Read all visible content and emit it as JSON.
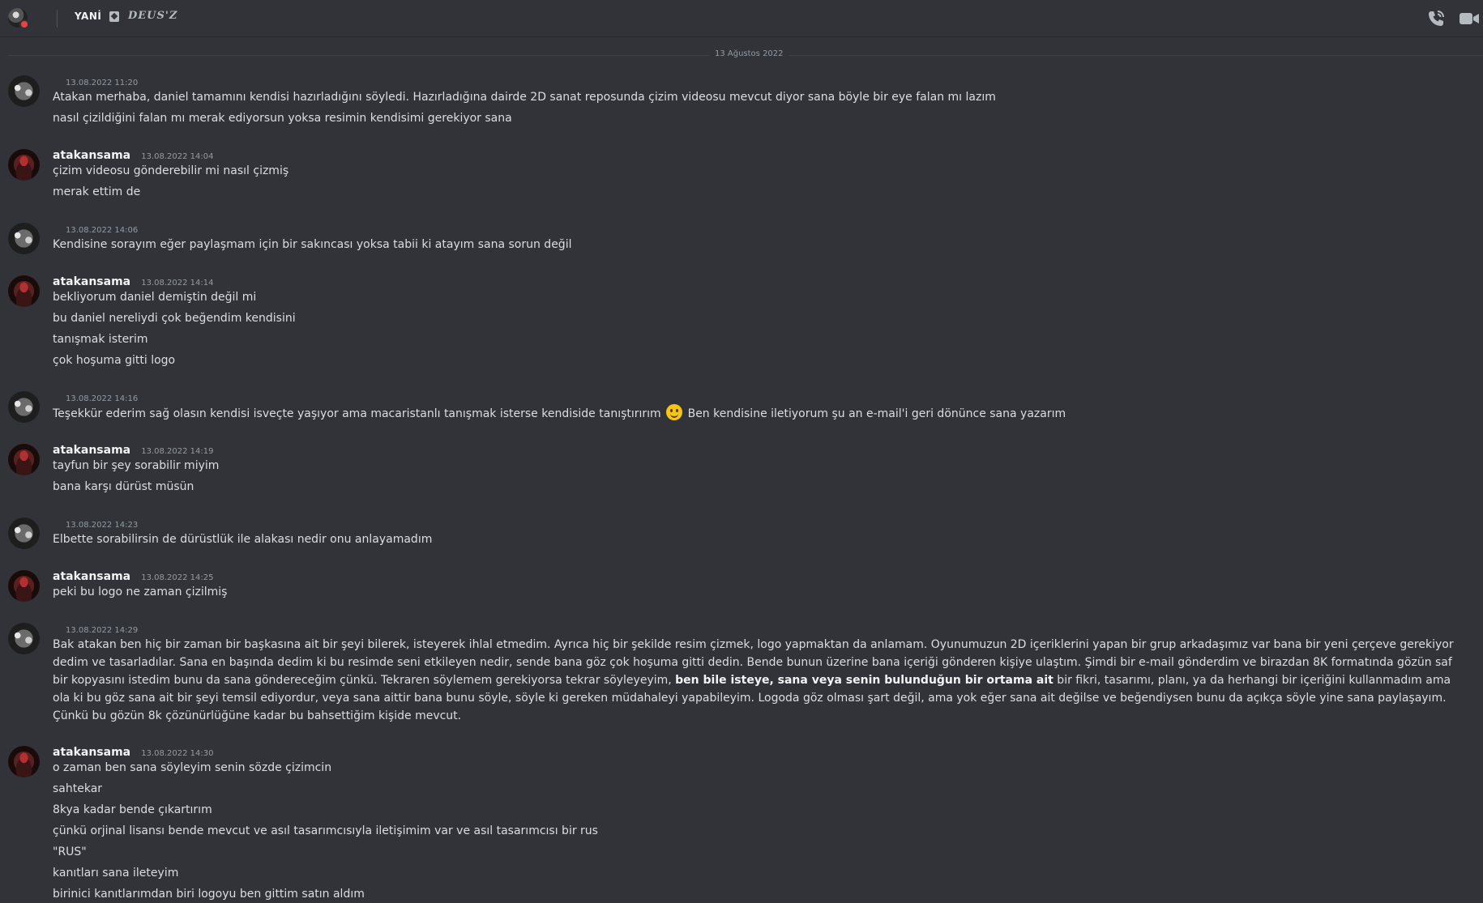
{
  "header": {
    "username": "YANİ",
    "status_text": "DEUS'Z",
    "icons": [
      "avatar",
      "status-icon",
      "phone-call-icon",
      "video-call-icon"
    ]
  },
  "date_separator": "13 Ağustos 2022",
  "messages": [
    {
      "author": "",
      "time": "13.08.2022 11:20",
      "lines": [
        "Atakan merhaba, daniel tamamını kendisi hazırladığını söyledi. Hazırladığına dairde 2D sanat reposunda çizim videosu mevcut diyor sana böyle bir eye falan mı lazım",
        "nasıl çizildiğini falan mı merak ediyorsun yoksa resimin kendisimi gerekiyor sana"
      ]
    },
    {
      "author": "atakansama",
      "time": "13.08.2022 14:04",
      "lines": [
        "çizim videosu gönderebilir mi nasıl çizmiş",
        "merak ettim de"
      ]
    },
    {
      "author": "",
      "time": "13.08.2022 14:06",
      "lines": [
        "Kendisine sorayım eğer paylaşmam için bir sakıncası yoksa tabii ki atayım sana sorun değil"
      ]
    },
    {
      "author": "atakansama",
      "time": "13.08.2022 14:14",
      "lines": [
        "bekliyorum daniel demiştin değil mi",
        "bu daniel nereliydi çok beğendim kendisini",
        "tanışmak isterim",
        "çok hoşuma gitti logo"
      ]
    },
    {
      "author": "",
      "time": "13.08.2022 14:16",
      "line_before_emoji": "Teşekkür ederim sağ olasın kendisi isveçte yaşıyor ama macaristanlı tanışmak isterse kendiside tanıştırırım",
      "line_after_emoji": "Ben kendisine iletiyorum şu an e-mail'i geri dönünce sana yazarım"
    },
    {
      "author": "atakansama",
      "time": "13.08.2022 14:19",
      "lines": [
        "tayfun bir şey sorabilir miyim",
        "bana karşı dürüst müsün"
      ]
    },
    {
      "author": "",
      "time": "13.08.2022 14:23",
      "lines": [
        "Elbette sorabilirsin de dürüstlük ile alakası nedir onu anlayamadım"
      ]
    },
    {
      "author": "atakansama",
      "time": "13.08.2022 14:25",
      "lines": [
        "peki bu logo ne zaman çizilmiş"
      ]
    },
    {
      "author": "",
      "time": "13.08.2022 14:29",
      "para_part1": "Bak atakan ben hiç bir zaman bir başkasına ait bir şeyi bilerek, isteyerek ihlal etmedim. Ayrıca hiç bir şekilde resim çizmek, logo yapmaktan da anlamam. Oyunumuzun 2D içeriklerini yapan bir grup arkadaşımız var bana bir yeni çerçeve gerekiyor dedim ve tasarladılar. Sana en başında dedim ki bu resimde seni etkileyen nedir, sende bana göz çok hoşuma gitti dedin. Bende bunun üzerine bana içeriği gönderen kişiye ulaştım. Şimdi bir e-mail gönderdim ve birazdan 8K formatında gözün saf bir kopyasını istedim bunu da sana göndereceğim çünkü. Tekraren söylemem gerekiyorsa tekrar söyleyeyim, ",
      "para_bold": "ben bile isteye, sana veya senin bulunduğun bir ortama ait",
      "para_part2": " bir fikri, tasarımı, planı, ya da herhangi bir içeriğini kullanmadım ama ola ki bu göz sana ait bir şeyi temsil ediyordur, veya sana aittir bana bunu söyle, söyle ki gereken müdahaleyi yapabileyim. Logoda göz olması şart değil, ama yok eğer sana ait değilse ve beğendiysen bunu da açıkça söyle yine sana paylaşayım. Çünkü bu gözün 8k çözünürlüğüne kadar bu bahsettiğim kişide mevcut."
    },
    {
      "author": "atakansama",
      "time": "13.08.2022 14:30",
      "lines": [
        "o zaman ben sana söyleyim senin sözde çizimcin",
        "sahtekar",
        "8kya kadar bende çıkartırım",
        "çünkü orjinal lisansı bende mevcut ve asıl tasarımcısıyla iletişimim var ve asıl tasarımcısı bir rus",
        "\"RUS\"",
        "kanıtları sana ileteyim",
        "birinici kanıtlarımdan biri logoyu ben gittim satın aldım"
      ]
    }
  ]
}
